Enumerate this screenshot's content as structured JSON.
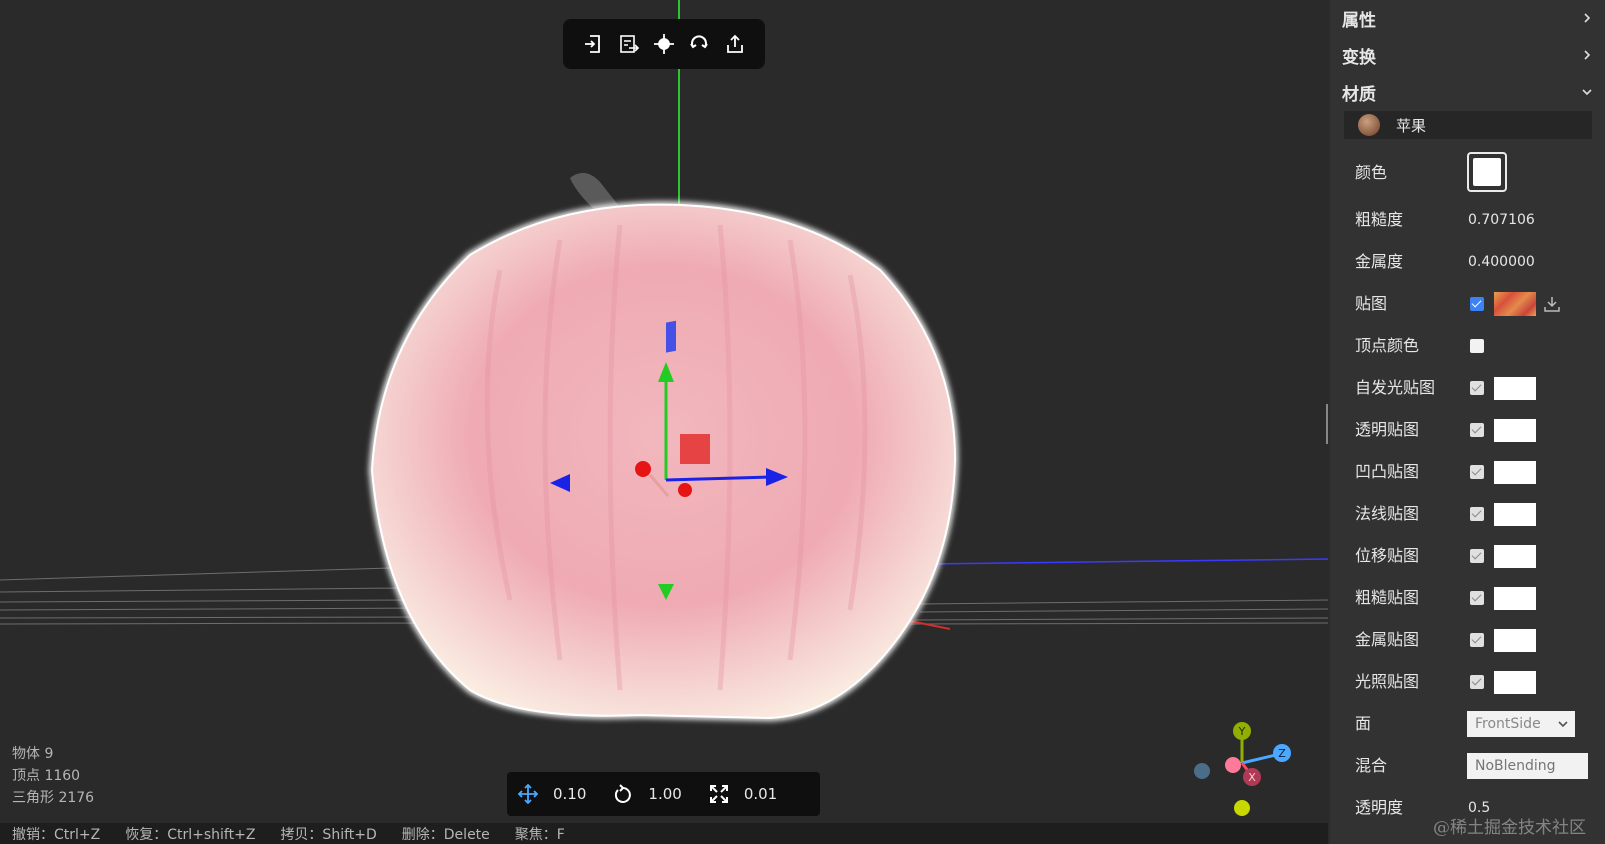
{
  "toolbar": {
    "icons": [
      "import-icon",
      "import-file-icon",
      "focus-target-icon",
      "rotate-reset-icon",
      "export-icon"
    ]
  },
  "stats": {
    "objects": "物体 9",
    "vertices": "顶点 1160",
    "triangles": "三角形 2176"
  },
  "transform": {
    "translate": "0.10",
    "rotate": "1.00",
    "scale": "0.01"
  },
  "shortcuts": [
    "撤销：Ctrl+Z",
    "恢复：Ctrl+shift+Z",
    "拷贝：Shift+D",
    "删除：Delete",
    "聚焦：F"
  ],
  "gizmo": {
    "y": "Y",
    "z": "Z",
    "x": "X"
  },
  "panel": {
    "sections": {
      "properties": "属性",
      "transform": "变换",
      "material": "材质"
    },
    "material_name": "苹果",
    "color_label": "颜色",
    "color_value": "#ffffff",
    "roughness_label": "粗糙度",
    "roughness_value": "0.707106",
    "metalness_label": "金属度",
    "metalness_value": "0.400000",
    "map_label": "贴图",
    "vertex_colors_label": "顶点颜色",
    "texture_rows": [
      {
        "label": "自发光贴图",
        "checked": true
      },
      {
        "label": "透明贴图",
        "checked": true
      },
      {
        "label": "凹凸贴图",
        "checked": true
      },
      {
        "label": "法线贴图",
        "checked": true
      },
      {
        "label": "位移贴图",
        "checked": true
      },
      {
        "label": "粗糙贴图",
        "checked": true
      },
      {
        "label": "金属贴图",
        "checked": true
      },
      {
        "label": "光照贴图",
        "checked": true
      }
    ],
    "side_label": "面",
    "side_value": "FrontSide",
    "blending_label": "混合",
    "blending_placeholder": "NoBlending",
    "opacity_label": "透明度",
    "opacity_value": "0.5"
  },
  "watermark": "@稀土掘金技术社区",
  "colors": {
    "accent_blue": "#3b82f6",
    "axis_x": "#ff4466",
    "axis_y": "#8fb000",
    "axis_z": "#4aa8ff"
  }
}
